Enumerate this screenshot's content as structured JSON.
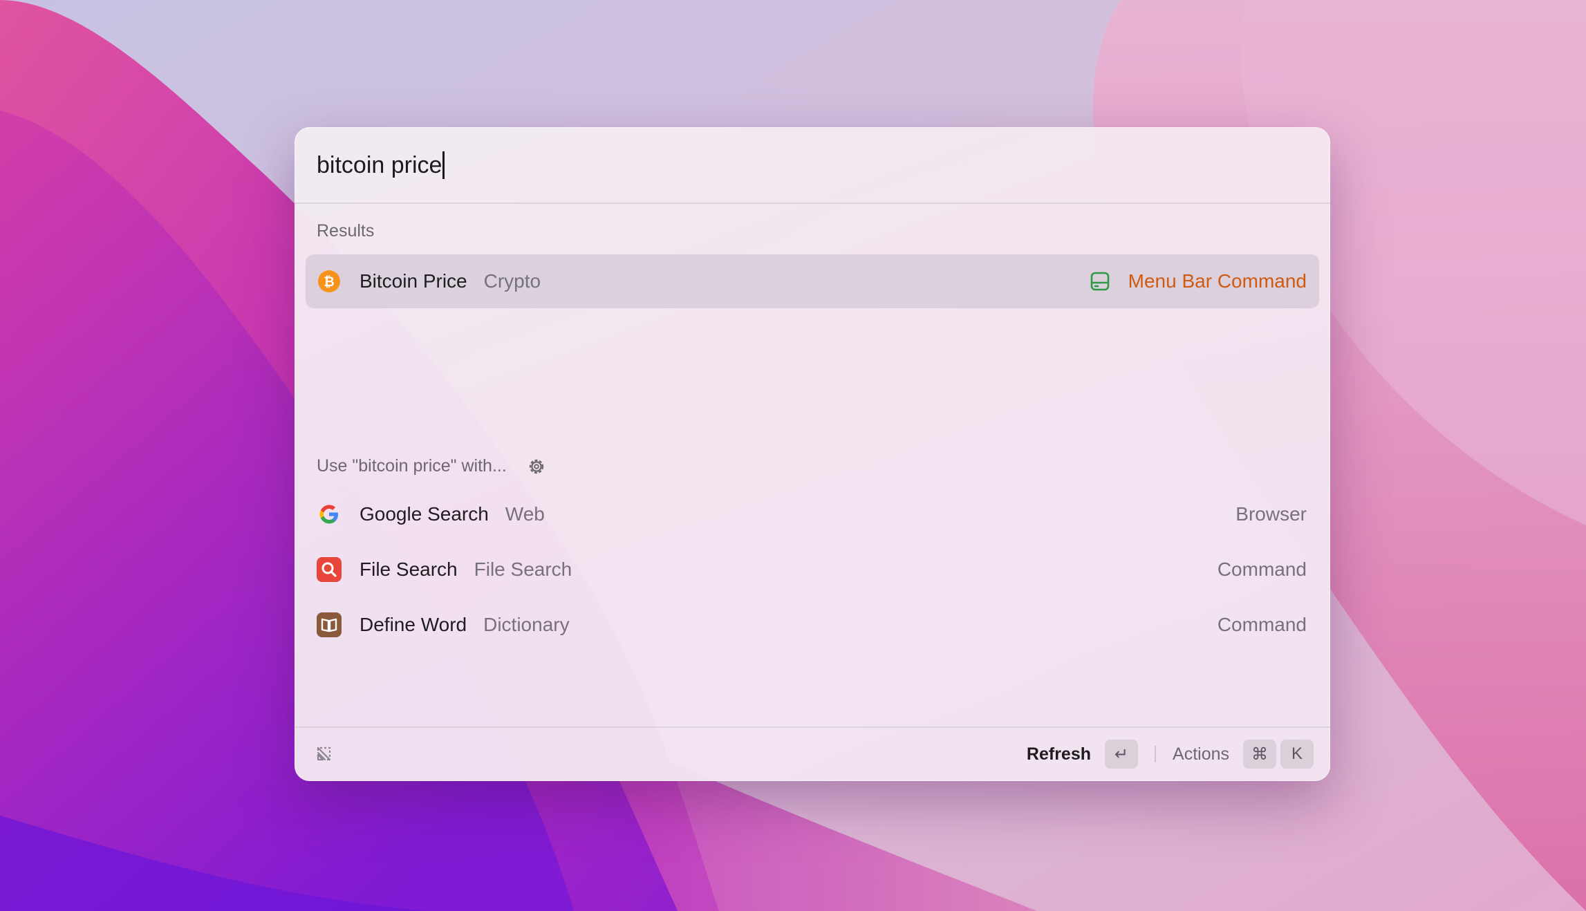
{
  "search": {
    "query": "bitcoin price"
  },
  "sections": {
    "results_label": "Results",
    "fallback_label": "Use \"bitcoin price\" with..."
  },
  "results": [
    {
      "title": "Bitcoin Price",
      "subtitle": "Crypto",
      "accessory": "Menu Bar Command",
      "icon": "bitcoin-icon",
      "selected": true
    }
  ],
  "fallbacks": [
    {
      "title": "Google Search",
      "subtitle": "Web",
      "accessory": "Browser",
      "icon": "google-icon"
    },
    {
      "title": "File Search",
      "subtitle": "File Search",
      "accessory": "Command",
      "icon": "magnifier-icon"
    },
    {
      "title": "Define Word",
      "subtitle": "Dictionary",
      "accessory": "Command",
      "icon": "book-icon"
    }
  ],
  "footer": {
    "primary_action": "Refresh",
    "primary_key": "↵",
    "actions_label": "Actions",
    "actions_keys": [
      "⌘",
      "K"
    ],
    "logo": "raycast-logo-icon"
  },
  "colors": {
    "accent_orange": "#cf5a12",
    "menu_bar_icon_green": "#2f9a46",
    "bitcoin_orange": "#f7931a",
    "file_search_red": "#e8453c",
    "dictionary_brown": "#8a5a3a"
  }
}
